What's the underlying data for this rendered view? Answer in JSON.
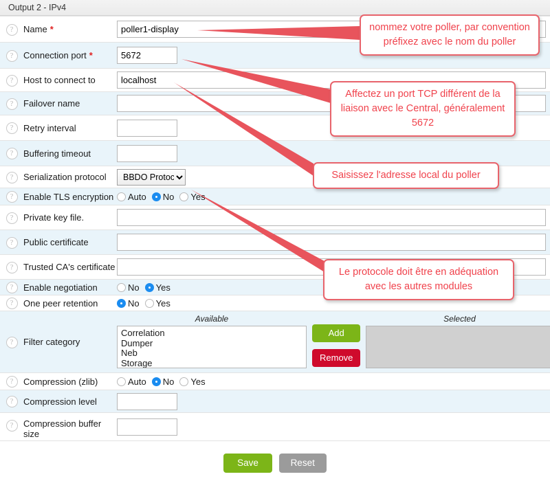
{
  "section": {
    "title": "Output 2 - IPv4"
  },
  "icons": {
    "help": "?",
    "required_marker": "*"
  },
  "form": {
    "rows": [
      {
        "label": "Name",
        "required": true,
        "type": "text",
        "value": "poller1-display",
        "width": "wide",
        "name": "name"
      },
      {
        "label": "Connection port",
        "required": true,
        "type": "text",
        "value": "5672",
        "width": "short",
        "name": "connection-port"
      },
      {
        "label": "Host to connect to",
        "required": false,
        "type": "text",
        "value": "localhost",
        "width": "wide",
        "name": "host-to-connect-to"
      },
      {
        "label": "Failover name",
        "required": false,
        "type": "text",
        "value": "",
        "width": "wide",
        "name": "failover-name"
      },
      {
        "label": "Retry interval",
        "required": false,
        "type": "text",
        "value": "",
        "width": "short",
        "name": "retry-interval"
      },
      {
        "label": "Buffering timeout",
        "required": false,
        "type": "text",
        "value": "",
        "width": "short",
        "name": "buffering-timeout"
      },
      {
        "label": "Serialization protocol",
        "required": false,
        "type": "select",
        "value": "BBDO Protocol",
        "options": [
          "BBDO Protocol"
        ],
        "name": "serialization-protocol"
      },
      {
        "label": "Enable TLS encryption",
        "required": false,
        "type": "radio",
        "options": [
          "Auto",
          "No",
          "Yes"
        ],
        "selected": "No",
        "name": "enable-tls-encryption"
      },
      {
        "label": "Private key file.",
        "required": false,
        "type": "text",
        "value": "",
        "width": "wide",
        "name": "private-key-file"
      },
      {
        "label": "Public certificate",
        "required": false,
        "type": "text",
        "value": "",
        "width": "wide",
        "name": "public-certificate"
      },
      {
        "label": "Trusted CA's certificate",
        "required": false,
        "type": "text",
        "value": "",
        "width": "wide",
        "name": "trusted-ca-certificate"
      },
      {
        "label": "Enable negotiation",
        "required": false,
        "type": "radio",
        "options": [
          "No",
          "Yes"
        ],
        "selected": "Yes",
        "name": "enable-negotiation"
      },
      {
        "label": "One peer retention",
        "required": false,
        "type": "radio",
        "options": [
          "No",
          "Yes"
        ],
        "selected": "No",
        "name": "one-peer-retention"
      },
      {
        "label": "Filter category",
        "required": false,
        "type": "duallist",
        "name": "filter-category"
      },
      {
        "label": "Compression (zlib)",
        "required": false,
        "type": "radio",
        "options": [
          "Auto",
          "No",
          "Yes"
        ],
        "selected": "No",
        "name": "compression-zlib"
      },
      {
        "label": "Compression level",
        "required": false,
        "type": "text",
        "value": "",
        "width": "short",
        "name": "compression-level"
      },
      {
        "label": "Compression buffer size",
        "required": false,
        "type": "text",
        "value": "",
        "width": "short",
        "name": "compression-buffer-size"
      }
    ]
  },
  "duallist": {
    "available_caption": "Available",
    "selected_caption": "Selected",
    "available_items": [
      "Correlation",
      "Dumper",
      "Neb",
      "Storage"
    ],
    "selected_items": [],
    "add_label": "Add",
    "remove_label": "Remove"
  },
  "footer": {
    "save_label": "Save",
    "reset_label": "Reset"
  },
  "callouts": [
    {
      "id": "name",
      "text": "nommez votre poller, par convention préfixez avec le nom du poller"
    },
    {
      "id": "port",
      "text": "Affectez un port TCP différent de la liaison avec le Central, généralement 5672"
    },
    {
      "id": "host",
      "text": "Saisissez l'adresse local du poller"
    },
    {
      "id": "proto",
      "text": "Le protocole doit être en adéquation avec les autres modules"
    }
  ],
  "colors": {
    "callout_border": "#e8636b",
    "callout_text": "#f0424c",
    "radio_selected": "#1a8cf0",
    "button_green": "#7cb518",
    "button_red": "#cf0a2c",
    "button_gray": "#9b9b9b",
    "row_even": "#e9f4fa",
    "selected_box": "#d0d0d0"
  }
}
